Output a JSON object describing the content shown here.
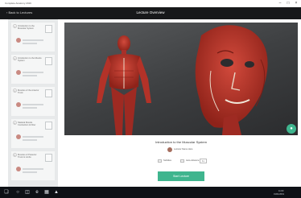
{
  "window": {
    "title": "Complete Anatomy 2019",
    "controls": [
      "–",
      "□",
      "×"
    ]
  },
  "header": {
    "back_label": "‹  Back to Lectures",
    "title": "Lecture Overview"
  },
  "sidebar": {
    "items": [
      {
        "index": "1",
        "title": "Introduction to the Muscular System"
      },
      {
        "index": "2",
        "title": "Introduction to the Muscle System"
      },
      {
        "index": "3",
        "title": "Muscles of the Anterior Trunk"
      },
      {
        "index": "4",
        "title": "Skeletal Muscle Contraction & Fiber"
      },
      {
        "index": "5",
        "title": "Muscles of Posterior Trunk & Limbs"
      }
    ]
  },
  "lecture": {
    "title": "Introduction to the Muscular System",
    "presenter": "Lecturer Name Here",
    "options": [
      "Subtitles",
      "Auto-Advance"
    ],
    "speed": "1x",
    "start_label": "Start Lecture"
  },
  "taskbar": {
    "time": "11:00",
    "date": "01/01/2019"
  },
  "colors": {
    "accent": "#3fb58e",
    "header": "#17181a",
    "taskbar": "#0e1116"
  },
  "icons": {
    "fab": "chat-icon",
    "start": "windows-start-icon",
    "search": "search-icon",
    "task_view": "task-view-icon",
    "browser": "browser-icon",
    "files": "folder-icon",
    "app": "app-icon"
  }
}
